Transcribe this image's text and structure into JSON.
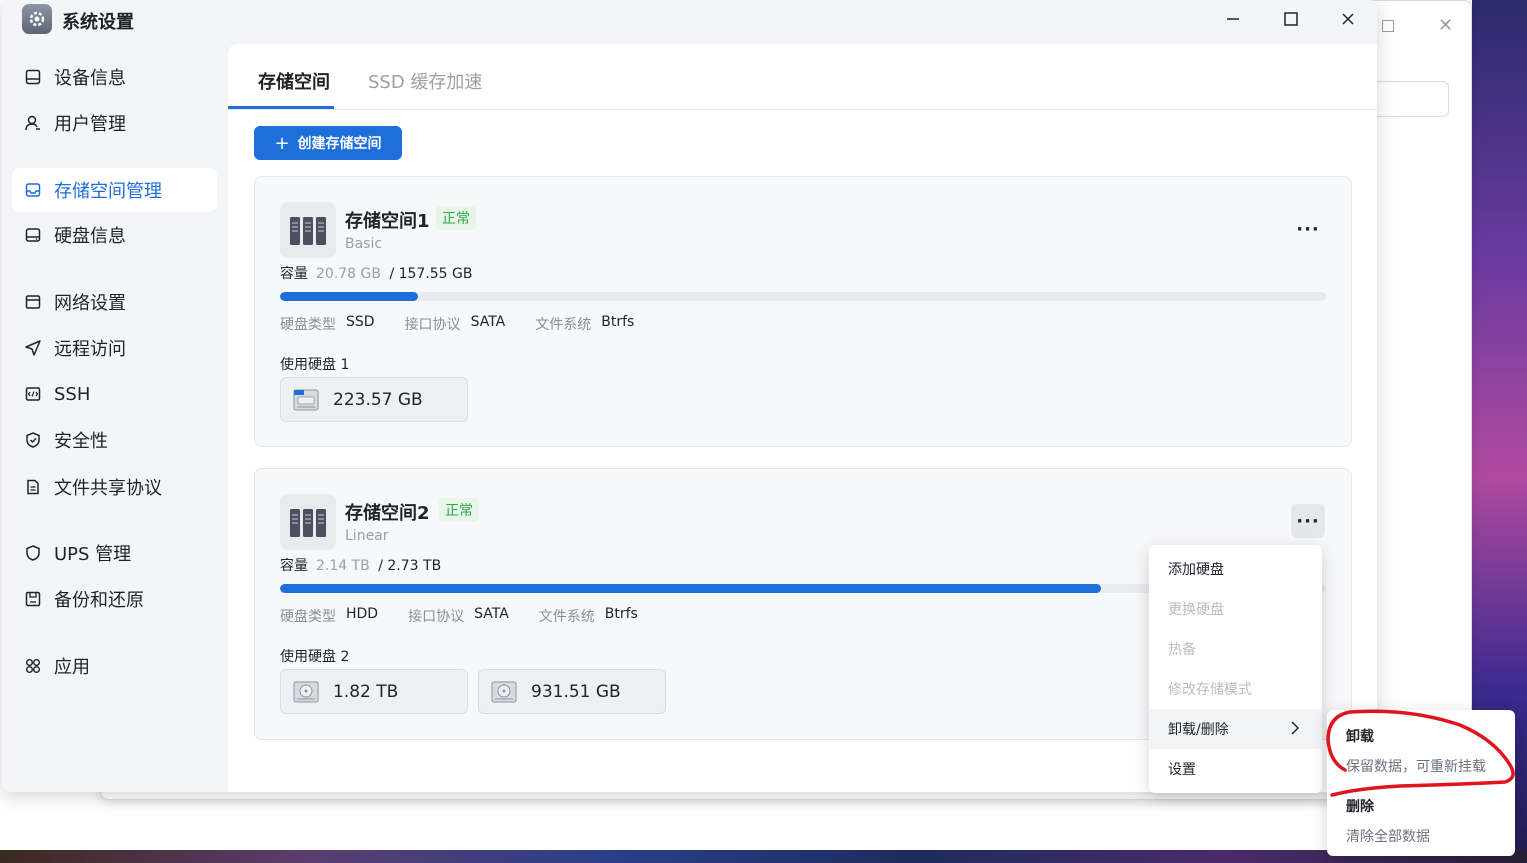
{
  "window": {
    "title": "系统设置",
    "controls": {
      "minimize": "—",
      "maximize": "☐",
      "close": "✕"
    }
  },
  "sidebar": {
    "items": [
      {
        "label": "设备信息",
        "icon": "device-info-icon"
      },
      {
        "label": "用户管理",
        "icon": "user-icon"
      },
      {
        "label": "存储空间管理",
        "icon": "storage-icon",
        "active": true
      },
      {
        "label": "硬盘信息",
        "icon": "disk-icon"
      },
      {
        "label": "网络设置",
        "icon": "network-icon"
      },
      {
        "label": "远程访问",
        "icon": "send-icon"
      },
      {
        "label": "SSH",
        "icon": "terminal-icon"
      },
      {
        "label": "安全性",
        "icon": "shield-icon"
      },
      {
        "label": "文件共享协议",
        "icon": "document-icon"
      },
      {
        "label": "UPS 管理",
        "icon": "ups-shield-icon"
      },
      {
        "label": "备份和还原",
        "icon": "backup-icon"
      },
      {
        "label": "应用",
        "icon": "apps-icon"
      }
    ]
  },
  "tabs": [
    {
      "label": "存储空间",
      "active": true
    },
    {
      "label": "SSD 缓存加速",
      "active": false
    }
  ],
  "create_button": {
    "label": "创建存储空间",
    "icon": "plus-icon"
  },
  "pools": [
    {
      "name": "存储空间1",
      "status": "正常",
      "type": "Basic",
      "capacity_label": "容量",
      "used": "20.78 GB",
      "total": "/ 157.55 GB",
      "usage_fraction": 0.132,
      "meta": [
        {
          "key": "硬盘类型",
          "value": "SSD"
        },
        {
          "key": "接口协议",
          "value": "SATA"
        },
        {
          "key": "文件系统",
          "value": "Btrfs"
        }
      ],
      "disks_label": "使用硬盘 1",
      "disks": [
        {
          "size": "223.57 GB",
          "icon": "ssd-icon"
        }
      ]
    },
    {
      "name": "存储空间2",
      "status": "正常",
      "type": "Linear",
      "capacity_label": "容量",
      "used": "2.14 TB",
      "total": "/ 2.73 TB",
      "usage_fraction": 0.785,
      "meta": [
        {
          "key": "硬盘类型",
          "value": "HDD"
        },
        {
          "key": "接口协议",
          "value": "SATA"
        },
        {
          "key": "文件系统",
          "value": "Btrfs"
        }
      ],
      "disks_label": "使用硬盘 2",
      "disks": [
        {
          "size": "1.82 TB",
          "icon": "hdd-icon"
        },
        {
          "size": "931.51 GB",
          "icon": "hdd-icon"
        }
      ]
    }
  ],
  "context_menu": {
    "items": [
      {
        "label": "添加硬盘",
        "enabled": true
      },
      {
        "label": "更换硬盘",
        "enabled": false
      },
      {
        "label": "热备",
        "enabled": false
      },
      {
        "label": "修改存储模式",
        "enabled": false
      },
      {
        "label": "卸载/删除",
        "enabled": true,
        "has_submenu": true
      },
      {
        "label": "设置",
        "enabled": true
      }
    ]
  },
  "submenu": {
    "items": [
      {
        "title": "卸载",
        "desc": "保留数据，可重新挂载"
      },
      {
        "title": "删除",
        "desc": "清除全部数据"
      }
    ]
  },
  "colors": {
    "accent": "#1e6fd9",
    "status_green": "#2fa845",
    "annotation_red": "#e0141e"
  }
}
